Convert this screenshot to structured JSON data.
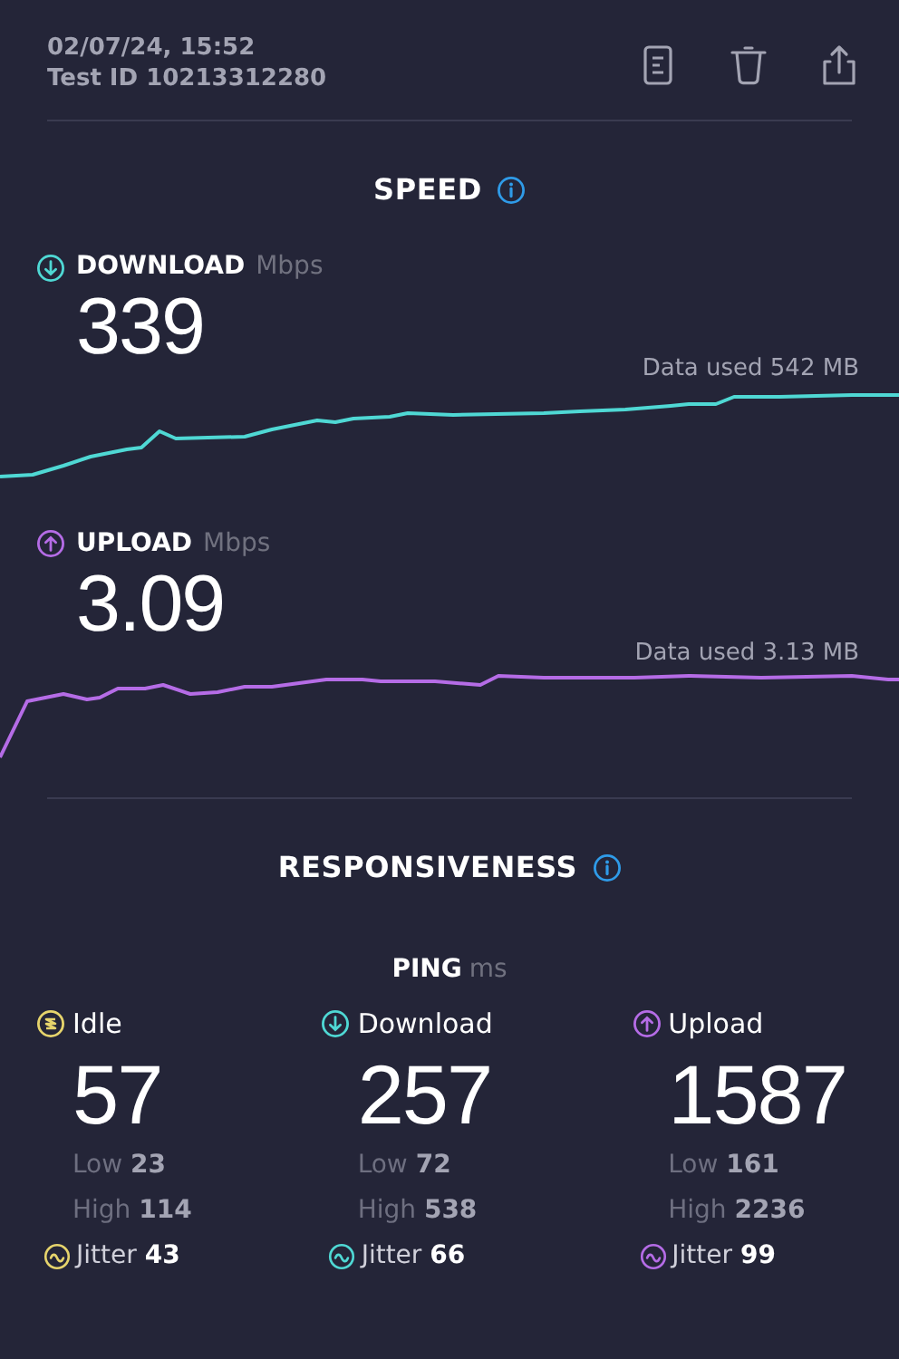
{
  "header": {
    "date": "02/07/24, 15:52",
    "test_id": "Test ID 10213312280"
  },
  "speed": {
    "title": "SPEED",
    "tests": [
      {
        "kind": "download",
        "label": "DOWNLOAD",
        "unit": "Mbps",
        "value": "339",
        "data_used": "Data used 542 MB",
        "color": "#4fd8d4"
      },
      {
        "kind": "upload",
        "label": "UPLOAD",
        "unit": "Mbps",
        "value": "3.09",
        "data_used": "Data used 3.13 MB",
        "color": "#b56ce6"
      }
    ]
  },
  "responsiveness": {
    "title": "RESPONSIVENESS",
    "ping_label": "PING",
    "ping_unit": "ms",
    "items": [
      {
        "kind": "idle",
        "label": "Idle",
        "value": "57",
        "low": "Low **23**",
        "high": "High **114**",
        "jitter": "Jitter **43**",
        "color": "#e6d46c"
      },
      {
        "kind": "download",
        "label": "Download",
        "value": "257",
        "low": "Low **72**",
        "high": "High **538**",
        "jitter": "Jitter **66**",
        "color": "#4fd8d4"
      },
      {
        "kind": "upload",
        "label": "Upload",
        "value": "1587",
        "low": "Low **161**",
        "high": "High **2236**",
        "jitter": "Jitter **99**",
        "color": "#b56ce6"
      }
    ]
  }
}
